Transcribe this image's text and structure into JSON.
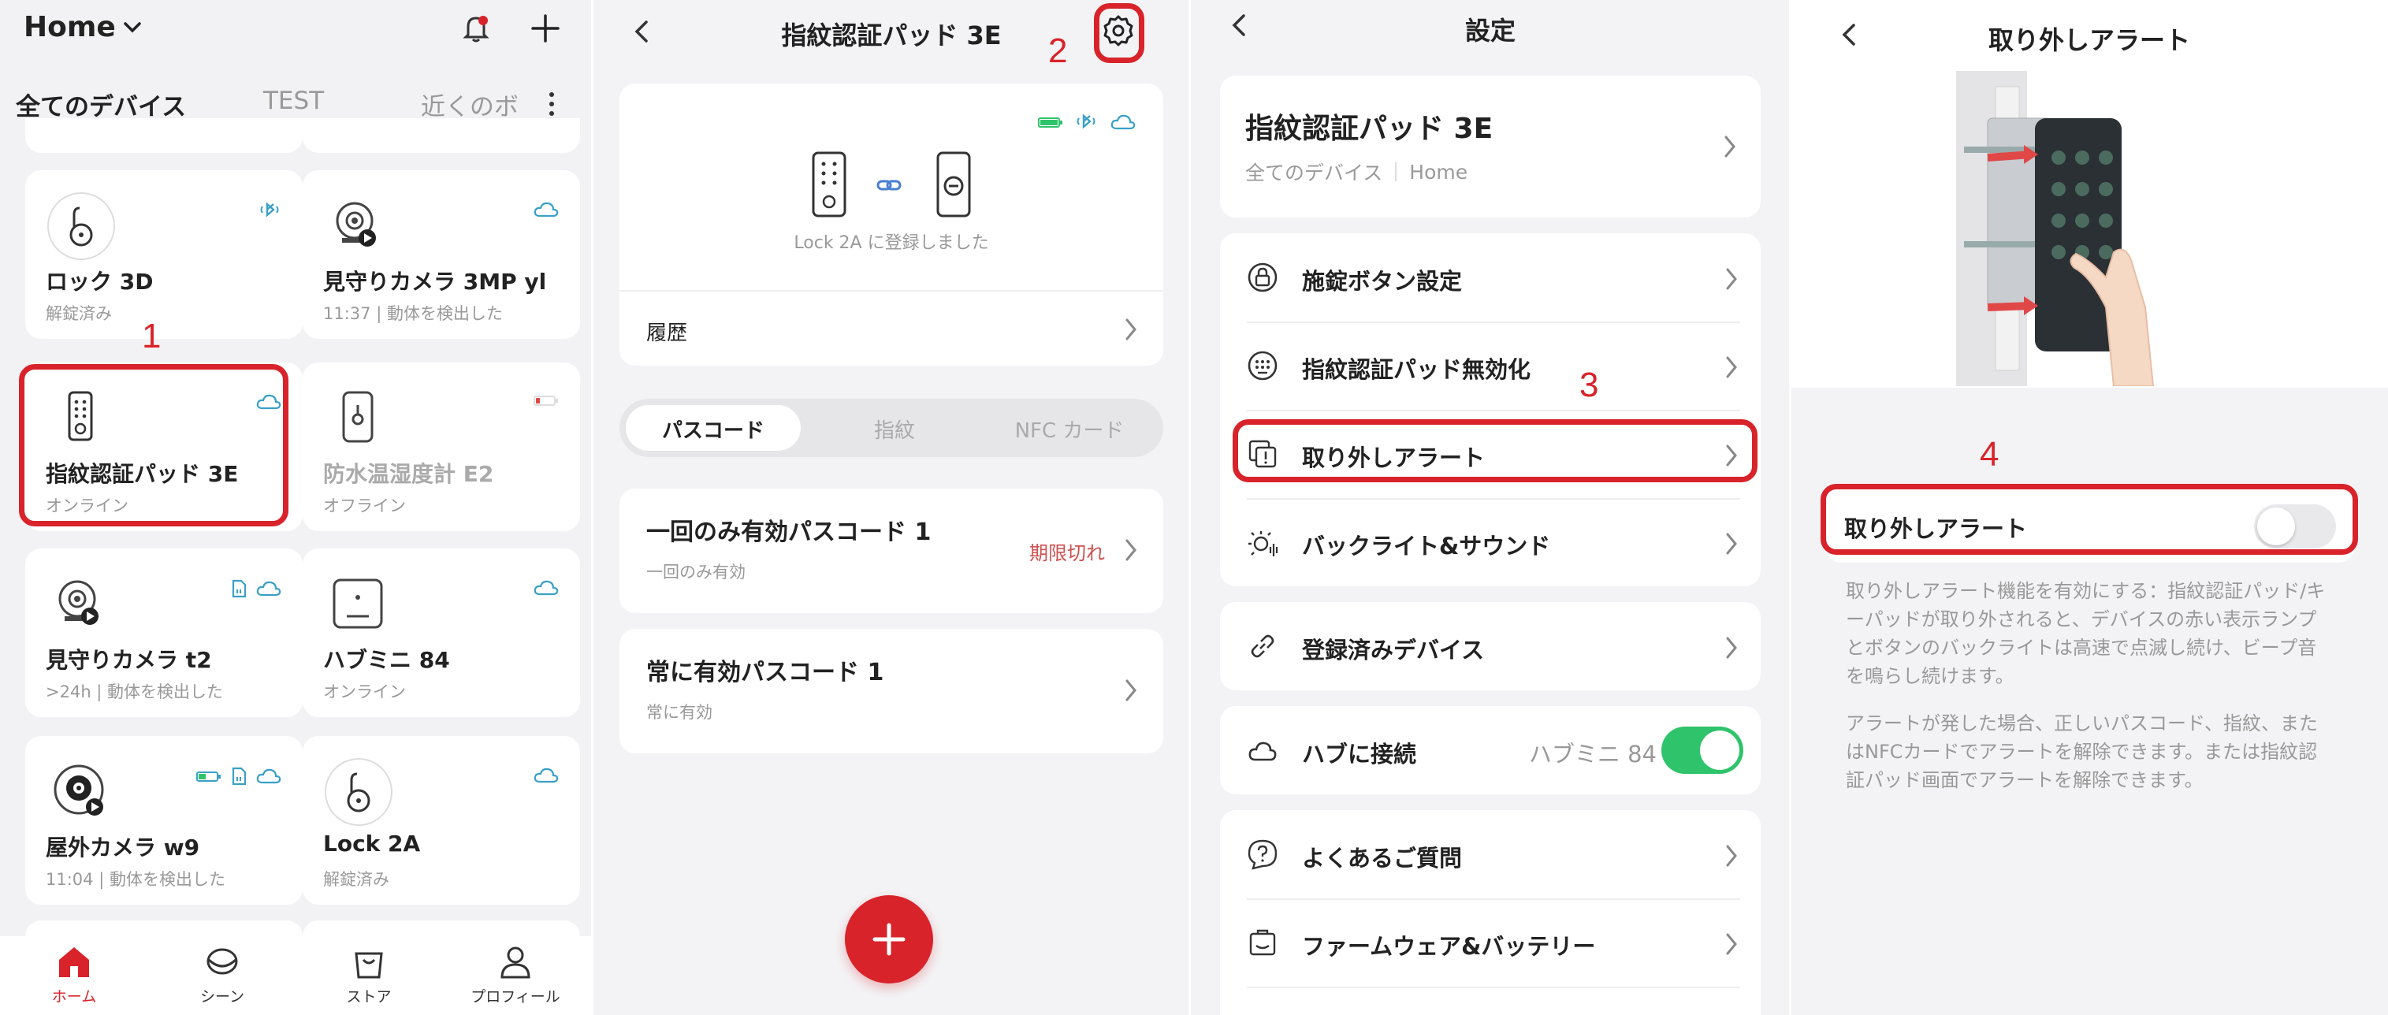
{
  "screen1": {
    "home_label": "Home",
    "tabs": [
      "全てのデバイス",
      "TEST",
      "近くのボ"
    ],
    "devices": [
      {
        "name": "ロック 3D",
        "status": "解錠済み",
        "icon": "lock-icon",
        "offline": false
      },
      {
        "name": "見守りカメラ 3MP yl",
        "status": "11:37 | 動体を検出した",
        "icon": "camera-icon",
        "offline": false
      },
      {
        "name": "指紋認証パッド 3E",
        "status": "オンライン",
        "icon": "keypad-icon",
        "offline": false
      },
      {
        "name": "防水温湿度計 E2",
        "status": "オフライン",
        "icon": "thermometer-icon",
        "offline": true
      },
      {
        "name": "見守りカメラ t2",
        "status": ">24h | 動体を検出した",
        "icon": "camera-icon",
        "offline": false
      },
      {
        "name": "ハブミニ 84",
        "status": "オンライン",
        "icon": "hub-icon",
        "offline": false
      },
      {
        "name": "屋外カメラ w9",
        "status": "11:04 | 動体を検出した",
        "icon": "outdoor-camera-icon",
        "offline": false
      },
      {
        "name": "Lock 2A",
        "status": "解錠済み",
        "icon": "lock-icon",
        "offline": false
      }
    ],
    "nav": [
      "ホーム",
      "シーン",
      "ストア",
      "プロフィール"
    ]
  },
  "screen2": {
    "title": "指紋認証パッド 3E",
    "lock_registered": "Lock 2A に登録しました",
    "history_label": "履歴",
    "segments": [
      "パスコード",
      "指紋",
      "NFC カード"
    ],
    "passcodes": [
      {
        "title": "一回のみ有効パスコード 1",
        "sub": "一回のみ有効",
        "state": "期限切れ"
      },
      {
        "title": "常に有効パスコード 1",
        "sub": "常に有効",
        "state": ""
      }
    ]
  },
  "screen3": {
    "title": "設定",
    "device_name": "指紋認証パッド 3E",
    "breadcrumb_all": "全てのデバイス",
    "breadcrumb_home": "Home",
    "items": [
      "施錠ボタン設定",
      "指紋認証パッド無効化",
      "取り外しアラート",
      "バックライト&サウンド",
      "登録済みデバイス",
      "ハブに接続",
      "よくあるご質問",
      "ファームウェア&バッテリー"
    ],
    "hub_value": "ハブミニ 84"
  },
  "screen4": {
    "title": "取り外しアラート",
    "toggle_label": "取り外しアラート",
    "desc1": "取り外しアラート機能を有効にする：指紋認証パッド/キーパッドが取り外されると、デバイスの赤い表示ランプとボタンのバックライトは高速で点滅し続け、ビープ音を鳴らし続けます。",
    "desc2": "アラートが発した場合、正しいパスコード、指紋、またはNFCカードでアラートを解除できます。または指紋認証パッド画面でアラートを解除できます。"
  },
  "annotations": [
    "1",
    "2",
    "3",
    "4"
  ],
  "colors": {
    "accent_red": "#d8232a",
    "toggle_on": "#2fc36b",
    "cloud_blue": "#3aa0c8",
    "expired": "#d05050"
  }
}
